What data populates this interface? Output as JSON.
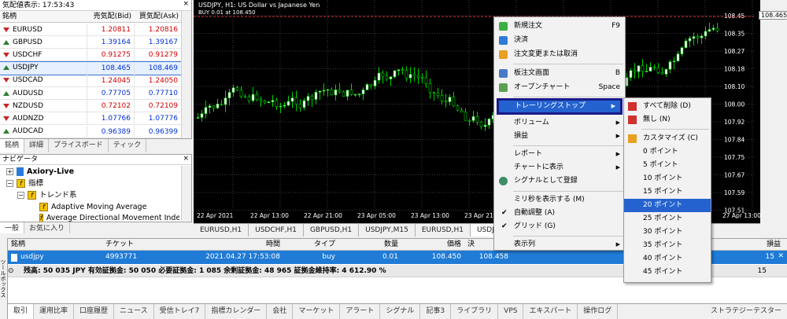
{
  "market_watch": {
    "title": "気配値表示: 17:53:43",
    "close": "×",
    "headers": {
      "symbol": "銘柄",
      "bid": "売気配(Bid)",
      "ask": "買気配(Ask)"
    },
    "rows": [
      {
        "symbol": "EURUSD",
        "bid": "1.20811",
        "ask": "1.20816",
        "dir": "down",
        "color": "red"
      },
      {
        "symbol": "GBPUSD",
        "bid": "1.39164",
        "ask": "1.39167",
        "dir": "up",
        "color": "blue"
      },
      {
        "symbol": "USDCHF",
        "bid": "0.91275",
        "ask": "0.91279",
        "dir": "down",
        "color": "red"
      },
      {
        "symbol": "USDJPY",
        "bid": "108.465",
        "ask": "108.469",
        "dir": "up",
        "color": "blue"
      },
      {
        "symbol": "USDCAD",
        "bid": "1.24045",
        "ask": "1.24050",
        "dir": "down",
        "color": "red"
      },
      {
        "symbol": "AUDUSD",
        "bid": "0.77705",
        "ask": "0.77710",
        "dir": "up",
        "color": "blue"
      },
      {
        "symbol": "NZDUSD",
        "bid": "0.72102",
        "ask": "0.72109",
        "dir": "down",
        "color": "red"
      },
      {
        "symbol": "AUDNZD",
        "bid": "1.07766",
        "ask": "1.07776",
        "dir": "down",
        "color": "blue"
      },
      {
        "symbol": "AUDCAD",
        "bid": "0.96389",
        "ask": "0.96399",
        "dir": "up",
        "color": "blue"
      }
    ],
    "tabs": [
      "銘柄",
      "詳細",
      "プライスボード",
      "ティック"
    ]
  },
  "navigator": {
    "title": "ナビゲータ",
    "close": "×",
    "items": [
      "Axiory-Live",
      "指標",
      "トレンド系",
      "Adaptive Moving Average",
      "Average Directional Movement Index"
    ],
    "tabs": [
      "一般",
      "お気に入り"
    ]
  },
  "chart": {
    "title": "USDJPY, H1:  US Dollar vs Japanese Yen",
    "subtitle": "BUY 0.01 at 108.450",
    "price_label": "108.465",
    "y_ticks": [
      "108.45",
      "108.35",
      "108.27",
      "108.18",
      "108.10",
      "108.00",
      "107.92",
      "107.84",
      "107.75",
      "107.67",
      "107.59",
      "107.51"
    ],
    "x_ticks": [
      "22 Apr 2021",
      "22 Apr 13:00",
      "22 Apr 21:00",
      "23 Apr 05:00",
      "23 Apr 13:00",
      "23 Apr 21:00",
      "27 Apr 13:00"
    ],
    "colors": {
      "bg": "#000000",
      "bull": "#ffffff",
      "bear": "#00d000",
      "grid": "#3a3a3a"
    }
  },
  "chart_tabs": [
    "EURUSD,H1",
    "USDCHF,H1",
    "GBPUSD,H1",
    "USDJPY,M15",
    "EURUSD,H1",
    "USDJPY,"
  ],
  "context_menu": {
    "items": [
      {
        "label": "新規注文",
        "shortcut": "F9"
      },
      {
        "label": "決済",
        "shortcut": ""
      },
      {
        "label": "注文変更または取消",
        "shortcut": ""
      },
      {
        "label": "板注文画面",
        "shortcut": "B"
      },
      {
        "label": "オープンチャート",
        "shortcut": "Space"
      },
      {
        "label": "トレーリングストップ",
        "shortcut": ""
      },
      {
        "label": "ボリューム",
        "shortcut": ""
      },
      {
        "label": "損益",
        "shortcut": ""
      },
      {
        "label": "レポート",
        "shortcut": ""
      },
      {
        "label": "チャートに表示",
        "shortcut": ""
      },
      {
        "label": "シグナルとして登録",
        "shortcut": ""
      },
      {
        "label": "ミリ秒を表示する (M)",
        "shortcut": ""
      },
      {
        "label": "自動調整 (A)",
        "shortcut": ""
      },
      {
        "label": "グリッド (G)",
        "shortcut": ""
      },
      {
        "label": "表示列",
        "shortcut": ""
      }
    ]
  },
  "trailing_submenu": {
    "items": [
      "すべて削除 (D)",
      "無し (N)",
      "カスタマイズ (C)",
      "0 ポイント",
      "5 ポイント",
      "10 ポイント",
      "15 ポイント",
      "20 ポイント",
      "25 ポイント",
      "30 ポイント",
      "35 ポイント",
      "40 ポイント",
      "45 ポイント"
    ]
  },
  "terminal": {
    "headers": [
      "銘柄",
      "チケット",
      "時間",
      "タイプ",
      "数量",
      "価格",
      "決",
      "損益"
    ],
    "row": {
      "symbol": "usdjpy",
      "ticket": "4993771",
      "time": "2021.04.27 17:53:08",
      "type": "buy",
      "volume": "0.01",
      "price": "108.450",
      "current": "108.458",
      "profit": "15"
    },
    "balance": "残高: 50 035 JPY  有効証拠金: 50 050  必要証拠金: 1 085  余剰証拠金: 48 965  証拠金維持率: 4 612.90 %",
    "balance_profit": "15",
    "side_label": "ツールボックス"
  },
  "bottom_tabs": [
    "取引",
    "運用比率",
    "口座履歴",
    "ニュース",
    "受信トレイ7",
    "指標カレンダー",
    "会社",
    "マーケット",
    "アラート",
    "シグナル",
    "記事3",
    "ライブラリ",
    "VPS",
    "エキスパート",
    "操作ログ"
  ],
  "strategy_tester": "ストラテジーテスター"
}
